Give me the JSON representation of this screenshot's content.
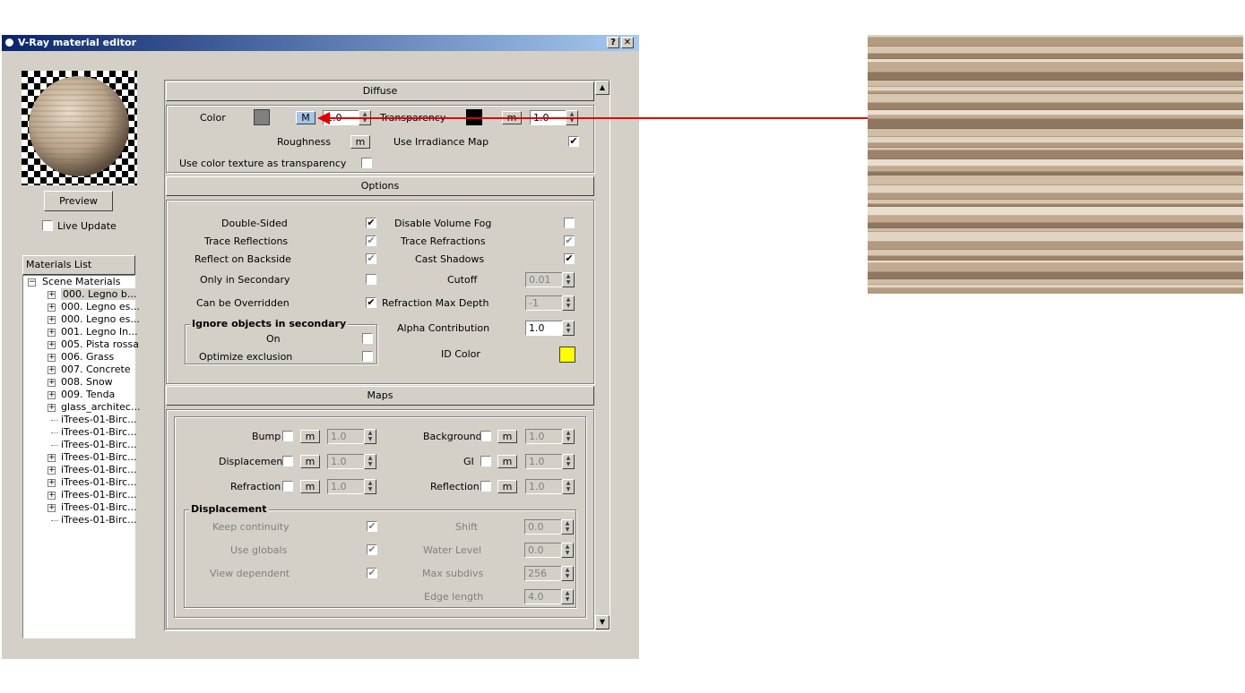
{
  "window": {
    "title": "V-Ray material editor",
    "help_btn": "?",
    "close_btn": "✕"
  },
  "left": {
    "preview_button": "Preview",
    "live_update": {
      "label": "Live Update",
      "checked": false
    },
    "materials_list_title": "Materials List",
    "tree_root": "Scene Materials",
    "tree_items": [
      {
        "label": "000. Legno b...",
        "expandable": true,
        "selected": true
      },
      {
        "label": "000. Legno es...",
        "expandable": true
      },
      {
        "label": "000. Legno es...",
        "expandable": true
      },
      {
        "label": "001. Legno In...",
        "expandable": true
      },
      {
        "label": "005. Pista rossa",
        "expandable": true
      },
      {
        "label": "006. Grass",
        "expandable": true
      },
      {
        "label": "007. Concrete",
        "expandable": true
      },
      {
        "label": "008. Snow",
        "expandable": true
      },
      {
        "label": "009. Tenda",
        "expandable": true
      },
      {
        "label": "glass_architec...",
        "expandable": true
      },
      {
        "label": "iTrees-01-Birc...",
        "expandable": false
      },
      {
        "label": "iTrees-01-Birc...",
        "expandable": false
      },
      {
        "label": "iTrees-01-Birc...",
        "expandable": false
      },
      {
        "label": "iTrees-01-Birc...",
        "expandable": true
      },
      {
        "label": "iTrees-01-Birc...",
        "expandable": true
      },
      {
        "label": "iTrees-01-Birc...",
        "expandable": true
      },
      {
        "label": "iTrees-01-Birc...",
        "expandable": true
      },
      {
        "label": "iTrees-01-Birc...",
        "expandable": true
      },
      {
        "label": "iTrees-01-Birc...",
        "expandable": false
      }
    ]
  },
  "diffuse": {
    "header": "Diffuse",
    "color_label": "Color",
    "color_swatch": "#808080",
    "color_map_btn": "M",
    "color_value": "1.0",
    "transparency_label": "Transparency",
    "transparency_swatch": "#000000",
    "transparency_map_btn": "m",
    "transparency_value": "1.0",
    "roughness_label": "Roughness",
    "roughness_map_btn": "m",
    "use_irradiance_label": "Use Irradiance Map",
    "use_irradiance_checked": "✔",
    "use_color_tex_label": "Use color texture as transparency"
  },
  "options": {
    "header": "Options",
    "double_sided": "Double-Sided",
    "trace_reflections": "Trace Reflections",
    "reflect_backside": "Reflect on Backside",
    "only_secondary": "Only in Secondary",
    "can_be_overridden": "Can be Overridden",
    "disable_volume_fog": "Disable Volume Fog",
    "trace_refractions": "Trace Refractions",
    "cast_shadows": "Cast Shadows",
    "cutoff": "Cutoff",
    "cutoff_value": "0.01",
    "refraction_max_depth": "Refraction Max Depth",
    "refraction_max_depth_value": "-1",
    "ignore_group": "Ignore objects in secondary",
    "on": "On",
    "optimize_exclusion": "Optimize exclusion",
    "alpha_contribution": "Alpha Contribution",
    "alpha_value": "1.0",
    "id_color": "ID Color",
    "id_color_swatch": "#ffff00",
    "check_mark": "✔"
  },
  "maps": {
    "header": "Maps",
    "map_btn": "m",
    "value": "1.0",
    "bump": "Bump",
    "displacement": "Displacement",
    "refraction": "Refraction",
    "background": "Background",
    "gi": "GI",
    "reflection": "Reflection",
    "disp_group": "Displacement",
    "keep_continuity": "Keep continuity",
    "use_globals": "Use globals",
    "view_dependent": "View dependent",
    "shift": "Shift",
    "shift_value": "0.0",
    "water_level": "Water Level",
    "water_level_value": "0.0",
    "max_subdivs": "Max subdivs",
    "max_subdivs_value": "256",
    "edge_length": "Edge length",
    "edge_length_value": "4.0"
  },
  "colors": {
    "arrow": "#e00000",
    "titlebar_start": "#0a246a",
    "titlebar_end": "#a6caf0"
  }
}
